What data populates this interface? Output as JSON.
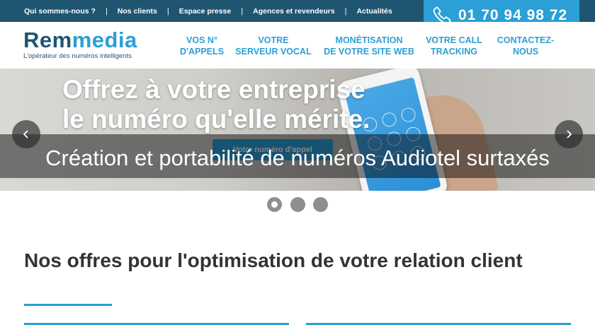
{
  "topbar": {
    "links": [
      "Qui sommes-nous ?",
      "Nos clients",
      "Espace presse",
      "Agences et revendeurs",
      "Actualités"
    ],
    "separator": "|",
    "phone": "01 70 94 98 72"
  },
  "logo": {
    "name_part1": "Rem",
    "name_part2": "media",
    "tagline": "L'opérateur des numéros intelligents"
  },
  "nav": {
    "items": [
      "VOS N°\nD'APPELS",
      "VOTRE\nSERVEUR VOCAL",
      "MONÉTISATION\nDE VOTRE SITE WEB",
      "VOTRE CALL\nTRACKING",
      "CONTACTEZ-\nNOUS"
    ]
  },
  "banner": {
    "headline_line1": "Offrez à votre entreprise",
    "headline_line2": "le numéro qu'elle mérite.",
    "button_label": "Votre numéro d'appel",
    "caption": "Création et portabilité de numéros Audiotel surtaxés"
  },
  "carousel": {
    "slide_count": 3,
    "active_index": 0
  },
  "section": {
    "title": "Nos offres pour l'optimisation de votre relation client"
  },
  "colors": {
    "dark_blue": "#1f5571",
    "accent_blue": "#2b9fd6",
    "text_dark": "#333333"
  },
  "icons": {
    "phone": "phone-icon",
    "prev": "chevron-left-icon",
    "next": "chevron-right-icon"
  }
}
